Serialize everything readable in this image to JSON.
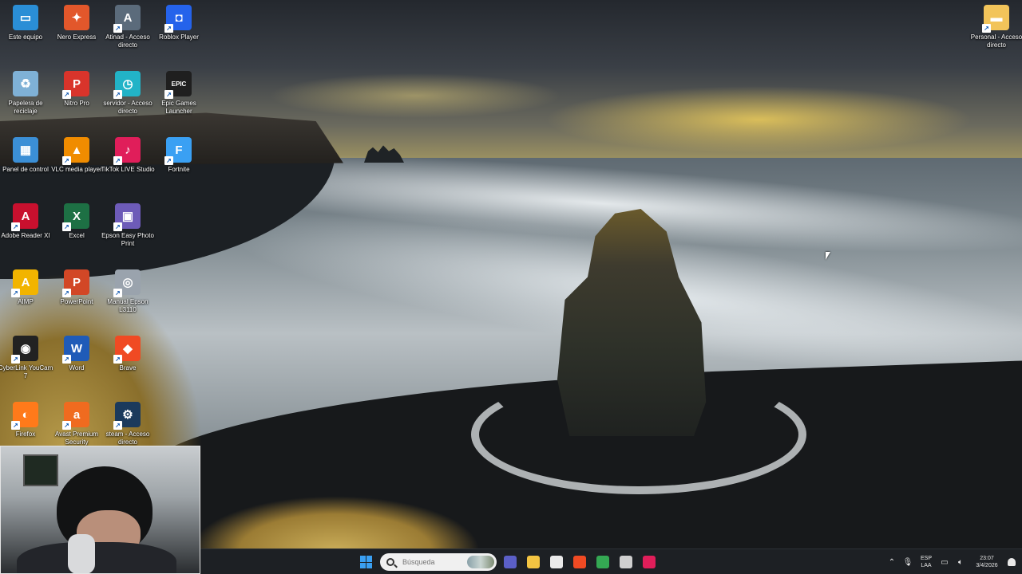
{
  "desktop": {
    "icons": [
      {
        "label": "Este equipo",
        "icon": "computer-icon",
        "color": "#2a8ed6",
        "glyph": "▭"
      },
      {
        "label": "Nero Express",
        "icon": "nero-flame-icon",
        "color": "#e2572b",
        "glyph": "✦"
      },
      {
        "label": "Atinad - Acceso directo",
        "icon": "atinad-compass-icon",
        "color": "#5b6b7b",
        "glyph": "A"
      },
      {
        "label": "Roblox Player",
        "icon": "roblox-icon",
        "color": "#2563eb",
        "glyph": "◘"
      },
      {
        "label": "Papelera de reciclaje",
        "icon": "recycle-bin-icon",
        "color": "#7fb1d6",
        "glyph": "♻"
      },
      {
        "label": "Nitro Pro",
        "icon": "nitro-pro-icon",
        "color": "#d9342b",
        "glyph": "P"
      },
      {
        "label": "servidor - Acceso directo",
        "icon": "server-clock-icon",
        "color": "#22b3c7",
        "glyph": "◷"
      },
      {
        "label": "Epic Games Launcher",
        "icon": "epic-games-icon",
        "color": "#1f1f1f",
        "glyph": "EPIC"
      },
      {
        "label": "Panel de control",
        "icon": "control-panel-icon",
        "color": "#3b8fd6",
        "glyph": "▦"
      },
      {
        "label": "VLC media player",
        "icon": "vlc-cone-icon",
        "color": "#f08c00",
        "glyph": "▲"
      },
      {
        "label": "TikTok LIVE Studio",
        "icon": "tiktok-live-icon",
        "color": "#e01e5a",
        "glyph": "♪"
      },
      {
        "label": "Fortnite",
        "icon": "fortnite-icon",
        "color": "#3aa0f3",
        "glyph": "F"
      },
      {
        "label": "Adobe Reader XI",
        "icon": "adobe-reader-icon",
        "color": "#c8102e",
        "glyph": "A"
      },
      {
        "label": "Excel",
        "icon": "excel-icon",
        "color": "#1d7044",
        "glyph": "X"
      },
      {
        "label": "Epson Easy Photo Print",
        "icon": "epson-photo-print-icon",
        "color": "#6d5bb8",
        "glyph": "▣"
      },
      {
        "label": "AIMP",
        "icon": "aimp-icon",
        "color": "#f2b400",
        "glyph": "A"
      },
      {
        "label": "PowerPoint",
        "icon": "powerpoint-icon",
        "color": "#d24726",
        "glyph": "P"
      },
      {
        "label": "Manual Epson L3110",
        "icon": "epson-manual-icon",
        "color": "#9aa3ad",
        "glyph": "◎"
      },
      {
        "label": "CyberLink YouCam 7",
        "icon": "youcam-icon",
        "color": "#222222",
        "glyph": "◉"
      },
      {
        "label": "Word",
        "icon": "word-icon",
        "color": "#1f5bb8",
        "glyph": "W"
      },
      {
        "label": "Brave",
        "icon": "brave-lion-icon",
        "color": "#f04a23",
        "glyph": "◆"
      },
      {
        "label": "Firefox",
        "icon": "firefox-icon",
        "color": "#ff7a1a",
        "glyph": "◐"
      },
      {
        "label": "Avast Premium Security",
        "icon": "avast-icon",
        "color": "#f06b1f",
        "glyph": "a"
      },
      {
        "label": "steam - Acceso directo",
        "icon": "steam-icon",
        "color": "#1b3a5c",
        "glyph": "⚙"
      },
      {
        "label": "Personal - Acceso directo",
        "icon": "folder-icon",
        "color": "#f2c45a",
        "glyph": "▬"
      }
    ]
  },
  "taskbar": {
    "search_placeholder": "Búsqueda",
    "apps": [
      {
        "icon": "meet-now-icon",
        "color": "#5b5fc7"
      },
      {
        "icon": "file-explorer-icon",
        "color": "#f4c542"
      },
      {
        "icon": "microsoft-store-icon",
        "color": "#eaeaea"
      },
      {
        "icon": "brave-browser-icon",
        "color": "#f04a23"
      },
      {
        "icon": "chrome-icon",
        "color": "#34a853"
      },
      {
        "icon": "cyberlink-icon",
        "color": "#cfcfcf"
      },
      {
        "icon": "tiktok-icon",
        "color": "#e01e5a"
      }
    ],
    "tray": {
      "language_line1": "ESP",
      "language_line2": "LAA",
      "time": "23:07",
      "date": "3/4/2026"
    }
  }
}
